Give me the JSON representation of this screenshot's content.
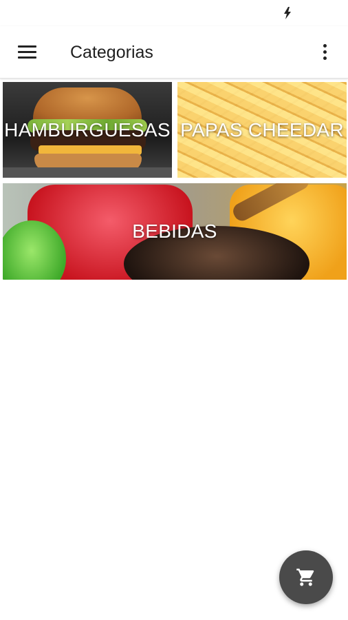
{
  "status_bar": {
    "icon": "charging-bolt-icon"
  },
  "app_bar": {
    "menu_icon": "hamburger-menu-icon",
    "title": "Categorias",
    "more_icon": "more-vert-icon"
  },
  "categories": [
    {
      "label": "HAMBURGUESAS",
      "image": "burger-photo"
    },
    {
      "label": "PAPAS CHEEDAR",
      "image": "fries-photo"
    },
    {
      "label": "BEBIDAS",
      "image": "drinks-photo"
    }
  ],
  "fab": {
    "icon": "shopping-cart-icon",
    "color": "#4a4a4a"
  }
}
